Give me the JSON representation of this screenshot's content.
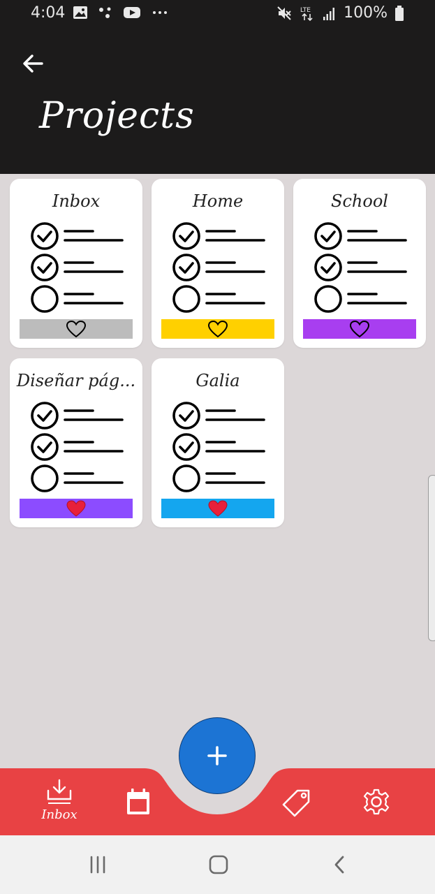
{
  "status_bar": {
    "time": "4:04",
    "battery": "100%",
    "network": "LTE",
    "left_icons": [
      "gallery-icon",
      "dots-icon",
      "youtube-icon",
      "more-icon"
    ],
    "right_icons": [
      "mute-icon",
      "lte-icon",
      "signal-icon",
      "battery-icon"
    ]
  },
  "header": {
    "title": "Projects",
    "back_icon": "arrow-left-icon"
  },
  "projects": [
    {
      "name": "Inbox",
      "color": "#bcbcbc",
      "favorite": false
    },
    {
      "name": "Home",
      "color": "#ffd000",
      "favorite": false
    },
    {
      "name": "School",
      "color": "#a83ef0",
      "favorite": false
    },
    {
      "name": "Diseñar pág...",
      "color": "#8c4cff",
      "favorite": true
    },
    {
      "name": "Galia",
      "color": "#14a6ef",
      "favorite": true
    }
  ],
  "bottom_nav": {
    "inbox_label": "Inbox",
    "background": "#e84244",
    "items": [
      "inbox-icon",
      "calendar-icon",
      "tag-icon",
      "settings-icon"
    ]
  },
  "fab": {
    "icon": "plus-icon",
    "color": "#1c74d4"
  },
  "colors": {
    "header": "#1c1b1b",
    "background": "#dcd7d8",
    "heart_filled": "#e8203a"
  }
}
